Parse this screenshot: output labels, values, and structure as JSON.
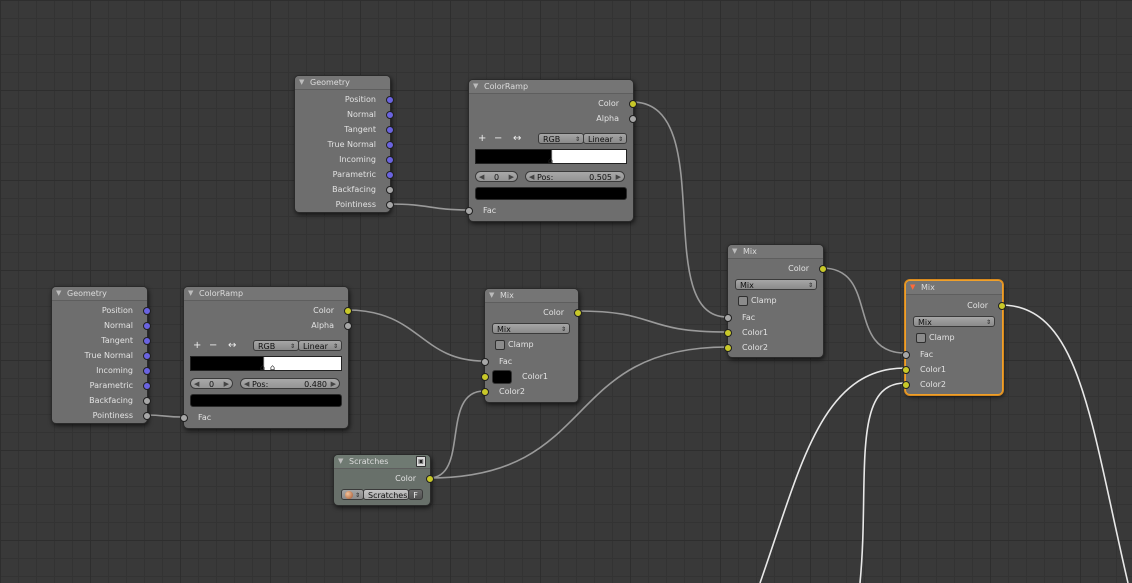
{
  "colors": {
    "vector_socket": "#6a63e0",
    "float_socket": "#a7a7a7",
    "color_socket": "#c8c829",
    "node_body": "#6e6e6e",
    "grid_background": "#393939",
    "selected_outline": "#f0a02a"
  },
  "geometry_top": {
    "title": "Geometry",
    "outputs": [
      "Position",
      "Normal",
      "Tangent",
      "True Normal",
      "Incoming",
      "Parametric",
      "Backfacing",
      "Pointiness"
    ]
  },
  "geometry_bottom": {
    "title": "Geometry",
    "outputs": [
      "Position",
      "Normal",
      "Tangent",
      "True Normal",
      "Incoming",
      "Parametric",
      "Backfacing",
      "Pointiness"
    ]
  },
  "colorramp_top": {
    "title": "ColorRamp",
    "out_color": "Color",
    "out_alpha": "Alpha",
    "add_icon": "+",
    "remove_icon": "−",
    "flip_icon": "↔",
    "color_mode": "RGB",
    "interpolation": "Linear",
    "index": "0",
    "pos_label": "Pos:",
    "pos_value": "0.505",
    "in_fac": "Fac"
  },
  "colorramp_bottom": {
    "title": "ColorRamp",
    "out_color": "Color",
    "out_alpha": "Alpha",
    "add_icon": "+",
    "remove_icon": "−",
    "flip_icon": "↔",
    "color_mode": "RGB",
    "interpolation": "Linear",
    "index": "0",
    "pos_label": "Pos:",
    "pos_value": "0.480",
    "in_fac": "Fac"
  },
  "mix_mid": {
    "title": "Mix",
    "out_color": "Color",
    "blend_mode": "Mix",
    "clamp_label": "Clamp",
    "in_fac": "Fac",
    "in_color1": "Color1",
    "in_color2": "Color2"
  },
  "mix_right": {
    "title": "Mix",
    "out_color": "Color",
    "blend_mode": "Mix",
    "clamp_label": "Clamp",
    "in_fac": "Fac",
    "in_color1": "Color1",
    "in_color2": "Color2"
  },
  "mix_selected": {
    "title": "Mix",
    "out_color": "Color",
    "blend_mode": "Mix",
    "clamp_label": "Clamp",
    "in_fac": "Fac",
    "in_color1": "Color1",
    "in_color2": "Color2"
  },
  "scratches": {
    "title": "Scratches",
    "out_color": "Color",
    "texture_name": "Scratches",
    "fake_user_label": "F"
  }
}
